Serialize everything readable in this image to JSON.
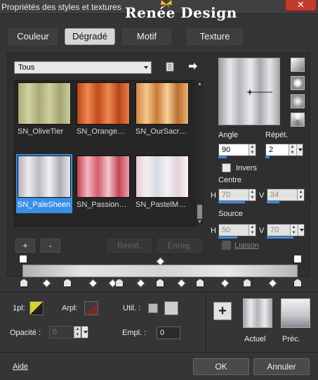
{
  "window": {
    "title": "Propriétés des styles et textures",
    "brand": "Renée Design",
    "close": "✕"
  },
  "tabs": [
    {
      "label": "Couleur"
    },
    {
      "label": "Dégradé",
      "active": true
    },
    {
      "label": "Motif"
    },
    {
      "label": "Texture"
    }
  ],
  "library": {
    "category": "Tous",
    "gradients": [
      {
        "label": "SN_OliveTier",
        "stops": [
          "#a8a878",
          "#d2d3a1",
          "#a9a878",
          "#cfd09e",
          "#a5a574",
          "#cacb9a"
        ]
      },
      {
        "label": "SN_Orange…",
        "stops": [
          "#b8441a",
          "#f08850",
          "#c04a1c",
          "#ee8a52",
          "#b8441a",
          "#e87e48"
        ]
      },
      {
        "label": "SN_OurSacr…",
        "stops": [
          "#d08440",
          "#f4c890",
          "#c87a38",
          "#f6d09a",
          "#b86e30",
          "#e8b478"
        ]
      },
      {
        "label": "SN_PaleSheen",
        "stops": [
          "#b4b0b8",
          "#ecebee",
          "#bcb8c0",
          "#f2f1f4",
          "#b0acb4",
          "#e8e6ea"
        ],
        "selected": true
      },
      {
        "label": "SN_Passion…",
        "stops": [
          "#c0404e",
          "#f4b8c2",
          "#d05c6a",
          "#f6c6ce",
          "#c44654",
          "#eaa4b0"
        ]
      },
      {
        "label": "SN_PastelM…",
        "stops": [
          "#e2cad2",
          "#f6eef0",
          "#d6dae8",
          "#f4f0f4",
          "#e6d0d8",
          "#faf4f6"
        ]
      }
    ],
    "add": "+",
    "remove": "-",
    "reset": "Réinit.",
    "save": "Enreg."
  },
  "settings": {
    "angle_label": "Angle",
    "angle": "90",
    "repeat_label": "Répét.",
    "repeat": "2",
    "invert_label": "Invers",
    "center_label": "Centre",
    "center_h_label": "H",
    "center_h": "70",
    "center_v_label": "V",
    "center_v": "34",
    "source_label": "Source",
    "source_h_label": "H",
    "source_h": "50",
    "source_v_label": "V",
    "source_v": "70",
    "link_label": "Liaison"
  },
  "stop_props": {
    "ipl_label": "1pl:",
    "arpl_label": "Arpl:",
    "util_label": "Util. :",
    "opacity_label": "Opacité :",
    "opacity": "0",
    "empl_label": "Empl. :",
    "empl": "0"
  },
  "compare": {
    "current_label": "Actuel",
    "previous_label": "Préc."
  },
  "footer": {
    "help": "Aide",
    "ok": "OK",
    "cancel": "Annuler"
  },
  "colors": {
    "accent": "#3a8ee6",
    "close": "#c23a2b"
  }
}
